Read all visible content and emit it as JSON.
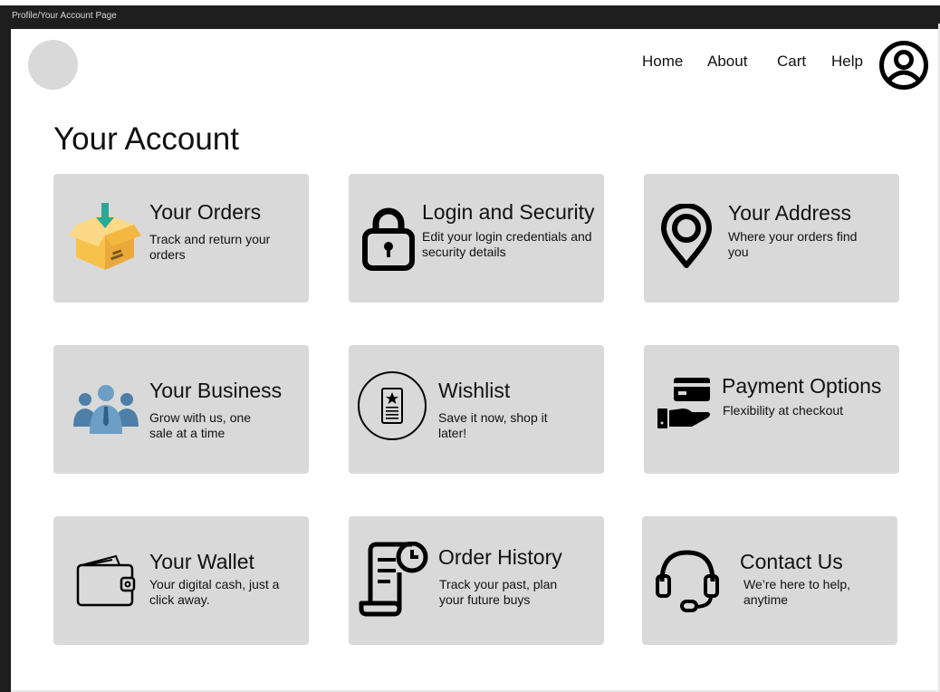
{
  "window": {
    "frame_label": "Profile/Your Account Page"
  },
  "nav": {
    "home": "Home",
    "about": "About",
    "cart": "Cart",
    "help": "Help",
    "account_icon": "user-circle-icon"
  },
  "page": {
    "title": "Your Account"
  },
  "cards": [
    {
      "title": "Your Orders",
      "desc": "Track and return your orders",
      "icon": "package-box-icon"
    },
    {
      "title": "Login and Security",
      "desc": "Edit your login credentials and security details",
      "icon": "lock-icon"
    },
    {
      "title": "Your Address",
      "desc": "Where your orders find you",
      "icon": "location-pin-icon"
    },
    {
      "title": "Your Business",
      "desc": "Grow with us, one sale at a time",
      "icon": "business-people-icon"
    },
    {
      "title": "Wishlist",
      "desc": "Save it now, shop it later!",
      "icon": "wishlist-receipt-icon"
    },
    {
      "title": "Payment Options",
      "desc": "Flexibility at checkout",
      "icon": "card-in-hand-icon"
    },
    {
      "title": "Your Wallet",
      "desc": "Your digital cash, just a click away.",
      "icon": "wallet-icon"
    },
    {
      "title": "Order History",
      "desc": "Track your past, plan your future buys",
      "icon": "scroll-clock-icon"
    },
    {
      "title": "Contact Us",
      "desc": "We’re here to help, anytime",
      "icon": "headset-icon"
    }
  ],
  "colors": {
    "card_bg": "#d9d9d9",
    "frame_dark": "#1e1e1e",
    "box_yellow": "#f6c24a",
    "arrow_teal": "#2aa899",
    "people_blue": "#4d7fa8"
  }
}
